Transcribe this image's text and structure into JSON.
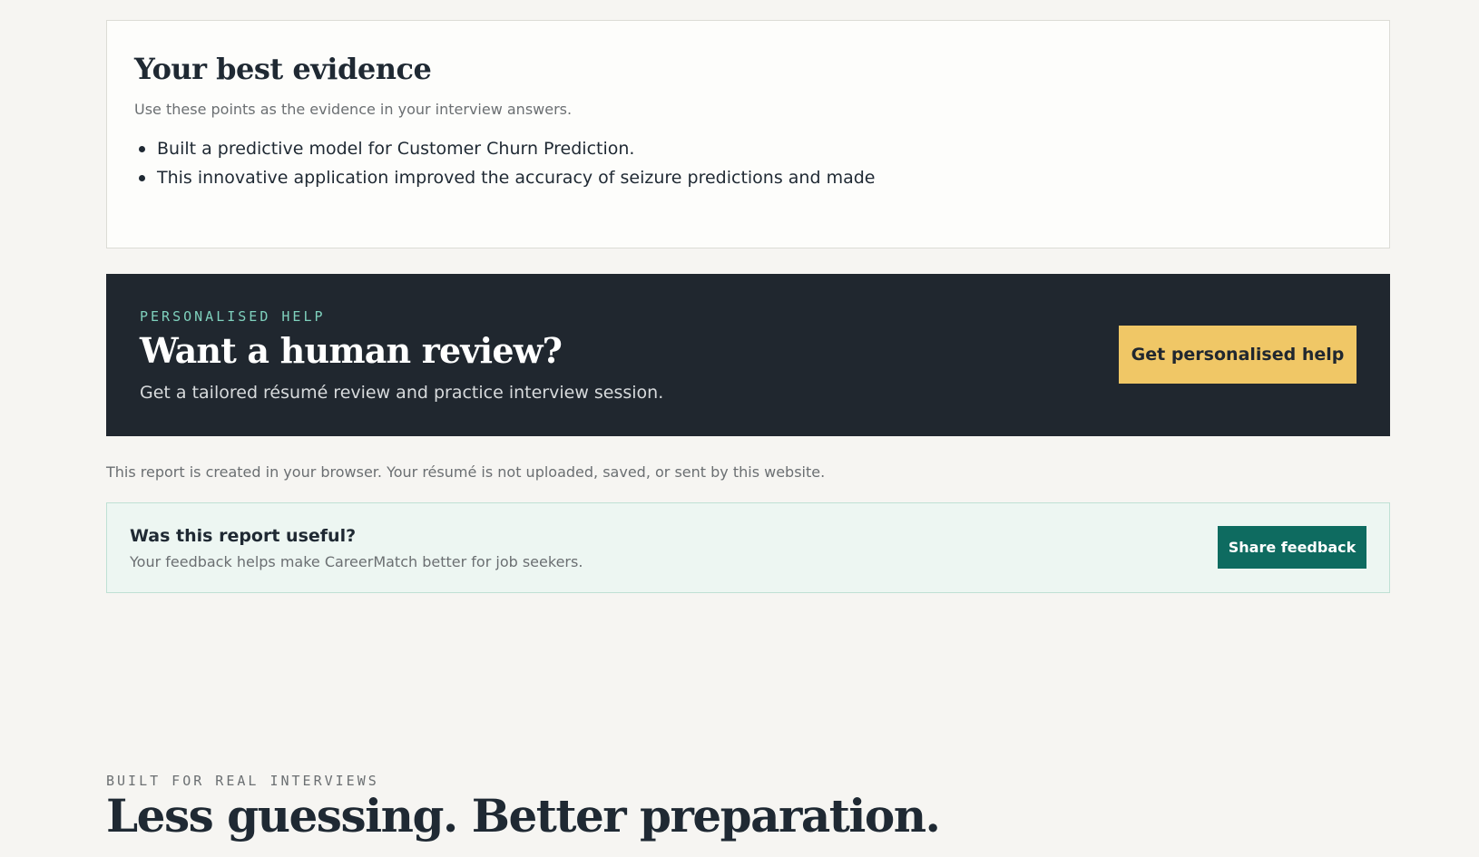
{
  "evidence": {
    "title": "Your best evidence",
    "subtitle": "Use these points as the evidence in your interview answers.",
    "items": [
      "Built a predictive model for Customer Churn Prediction.",
      "This innovative application improved the accuracy of seizure predictions and made"
    ]
  },
  "review": {
    "eyebrow": "PERSONALISED HELP",
    "title": "Want a human review?",
    "text": "Get a tailored résumé review and practice interview session.",
    "button_label": "Get personalised help"
  },
  "privacy": {
    "note": "This report is created in your browser. Your résumé is not uploaded, saved, or sent by this website."
  },
  "feedback": {
    "title": "Was this report useful?",
    "text": "Your feedback helps make CareerMatch better for job seekers.",
    "button_label": "Share feedback"
  },
  "bottom": {
    "eyebrow": "BUILT FOR REAL INTERVIEWS",
    "title": "Less guessing. Better preparation."
  },
  "colors": {
    "page_background": "#f6f5f2",
    "banner_background": "#20272f",
    "accent_yellow": "#f0c766",
    "accent_teal": "#0e6b60",
    "eyebrow_mint": "#7fd1bd"
  }
}
